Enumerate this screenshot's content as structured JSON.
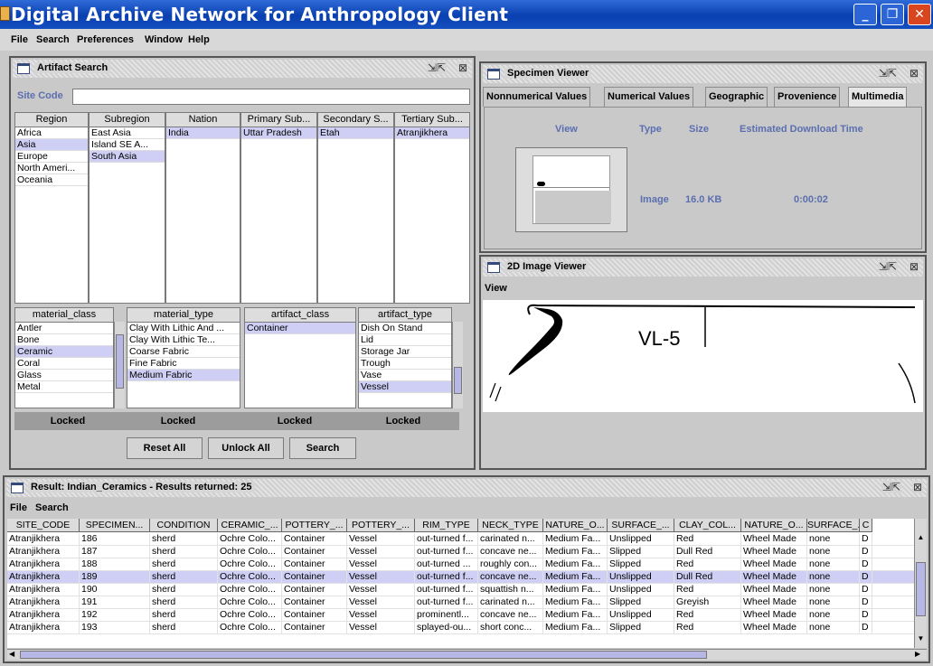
{
  "app": {
    "title": "Digital Archive Network for Anthropology Client"
  },
  "menubar": [
    "File",
    "Search",
    "Preferences",
    "Window",
    "Help"
  ],
  "artifact_search": {
    "title": "Artifact Search",
    "site_code_label": "Site Code",
    "site_code_value": "",
    "geo_columns": [
      {
        "header": "Region",
        "items": [
          "Africa",
          "Asia",
          "Europe",
          "North Ameri...",
          "Oceania"
        ],
        "selected": [
          1
        ]
      },
      {
        "header": "Subregion",
        "items": [
          "East Asia",
          "Island SE A...",
          "South Asia"
        ],
        "selected": [
          2
        ]
      },
      {
        "header": "Nation",
        "items": [
          "India"
        ],
        "selected": [
          0
        ]
      },
      {
        "header": "Primary Sub...",
        "items": [
          "Uttar Pradesh"
        ],
        "selected": [
          0
        ]
      },
      {
        "header": "Secondary S...",
        "items": [
          "Etah"
        ],
        "selected": [
          0
        ]
      },
      {
        "header": "Tertiary Sub...",
        "items": [
          "Atranjikhera"
        ],
        "selected": [
          0
        ]
      }
    ],
    "class_columns": [
      {
        "header": "material_class",
        "items": [
          "Antler",
          "Bone",
          "Ceramic",
          "Coral",
          "Glass",
          "Metal"
        ],
        "selected": [
          2
        ],
        "locked": "Locked"
      },
      {
        "header": "material_type",
        "items": [
          "Clay With Lithic And ...",
          "Clay With Lithic Te...",
          "Coarse Fabric",
          "Fine Fabric",
          "Medium Fabric"
        ],
        "selected": [
          4
        ],
        "locked": "Locked"
      },
      {
        "header": "artifact_class",
        "items": [
          "Container"
        ],
        "selected": [
          0
        ],
        "locked": "Locked"
      },
      {
        "header": "artifact_type",
        "items": [
          "Dish On Stand",
          "Lid",
          "Storage Jar",
          "Trough",
          "Vase",
          "Vessel"
        ],
        "selected": [
          5
        ],
        "locked": "Locked"
      }
    ],
    "buttons": {
      "reset": "Reset All",
      "unlock": "Unlock All",
      "search": "Search"
    }
  },
  "specimen_viewer": {
    "title": "Specimen Viewer",
    "tabs": [
      "Nonnumerical Values",
      "Numerical Values",
      "Geographic",
      "Provenience",
      "Multimedia"
    ],
    "active_tab": 4,
    "headers": [
      "View",
      "Type",
      "Size",
      "Estimated Download Time"
    ],
    "row": {
      "type": "Image",
      "size": "16.0 KB",
      "time": "0:00:02"
    }
  },
  "image_viewer": {
    "title": "2D Image Viewer",
    "view_label": "View",
    "sketch_label": "VL-5"
  },
  "results": {
    "title": "Result: Indian_Ceramics - Results returned: 25",
    "menu": [
      "File",
      "Search"
    ],
    "columns": [
      "SITE_CODE",
      "SPECIMEN...",
      "CONDITION",
      "CERAMIC_...",
      "POTTERY_...",
      "POTTERY_...",
      "RIM_TYPE",
      "NECK_TYPE",
      "NATURE_O...",
      "SURFACE_...",
      "CLAY_COL...",
      "NATURE_O...",
      "SURFACE_...",
      "C"
    ],
    "rows": [
      [
        "Atranjikhera",
        "186",
        "sherd",
        "Ochre Colo...",
        "Container",
        "Vessel",
        "out-turned f...",
        "carinated n...",
        "Medium Fa...",
        "Unslipped",
        "Red",
        "Wheel Made",
        "none",
        "D"
      ],
      [
        "Atranjikhera",
        "187",
        "sherd",
        "Ochre Colo...",
        "Container",
        "Vessel",
        "out-turned f...",
        "concave ne...",
        "Medium Fa...",
        "Slipped",
        "Dull Red",
        "Wheel Made",
        "none",
        "D"
      ],
      [
        "Atranjikhera",
        "188",
        "sherd",
        "Ochre Colo...",
        "Container",
        "Vessel",
        "out-turned ...",
        "roughly con...",
        "Medium Fa...",
        "Slipped",
        "Red",
        "Wheel Made",
        "none",
        "D"
      ],
      [
        "Atranjikhera",
        "189",
        "sherd",
        "Ochre Colo...",
        "Container",
        "Vessel",
        "out-turned f...",
        "concave ne...",
        "Medium Fa...",
        "Unslipped",
        "Dull Red",
        "Wheel Made",
        "none",
        "D"
      ],
      [
        "Atranjikhera",
        "190",
        "sherd",
        "Ochre Colo...",
        "Container",
        "Vessel",
        "out-turned f...",
        "squattish n...",
        "Medium Fa...",
        "Unslipped",
        "Red",
        "Wheel Made",
        "none",
        "D"
      ],
      [
        "Atranjikhera",
        "191",
        "sherd",
        "Ochre Colo...",
        "Container",
        "Vessel",
        "out-turned f...",
        "carinated n...",
        "Medium Fa...",
        "Slipped",
        "Greyish",
        "Wheel Made",
        "none",
        "D"
      ],
      [
        "Atranjikhera",
        "192",
        "sherd",
        "Ochre Colo...",
        "Container",
        "Vessel",
        "prominentl...",
        "concave ne...",
        "Medium Fa...",
        "Unslipped",
        "Red",
        "Wheel Made",
        "none",
        "D"
      ],
      [
        "Atranjikhera",
        "193",
        "sherd",
        "Ochre Colo...",
        "Container",
        "Vessel",
        "splayed-ou...",
        "short conc...",
        "Medium Fa...",
        "Slipped",
        "Red",
        "Wheel Made",
        "none",
        "D"
      ]
    ],
    "selected_row": 3
  },
  "colors": {
    "titlebar": "#0a3fb0",
    "selection": "#cfcff5",
    "locked_bg": "#9c9c9c",
    "header_text": "#5b6fb0"
  }
}
